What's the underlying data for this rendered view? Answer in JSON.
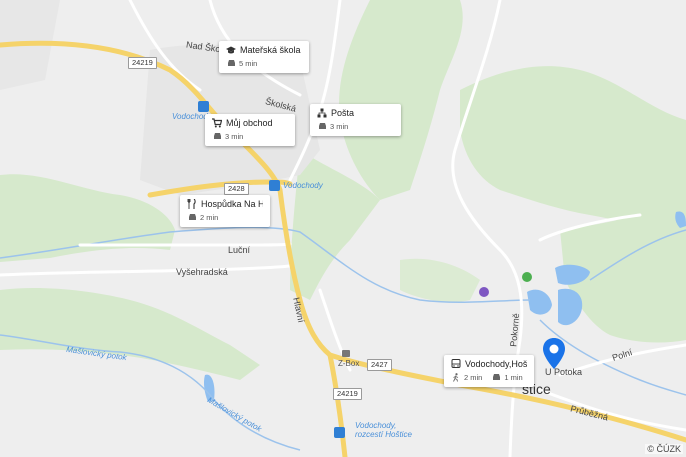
{
  "poi_cards": [
    {
      "id": "materska",
      "icon": "school-icon",
      "title": "Mateřská škola M...",
      "meta_icon": "car-icon",
      "time": "5 min"
    },
    {
      "id": "obchod",
      "icon": "shop-cart-icon",
      "title": "Můj obchod",
      "meta_icon": "car-icon",
      "time": "3 min"
    },
    {
      "id": "posta",
      "icon": "post-office-icon",
      "title": "Pošta",
      "meta_icon": "car-icon",
      "time": "3 min"
    },
    {
      "id": "hospudka",
      "icon": "restaurant-icon",
      "title": "Hospůdka Na Hřišti",
      "meta_icon": "car-icon",
      "time": "2 min"
    },
    {
      "id": "vodochody",
      "icon": "bus-icon",
      "title": "Vodochody,Hoštice",
      "walk_time": "2 min",
      "car_time": "1 min"
    }
  ],
  "road_numbers": [
    "24219",
    "2428",
    "2427",
    "24219"
  ],
  "street_names": [
    "Nad Škol",
    "Školská",
    "Luční",
    "Vyšehradská",
    "Hlavní",
    "Pokorně",
    "Polní",
    "Průběžná",
    "U Potoka"
  ],
  "stop_labels": [
    "Vodochod",
    "Vodochody",
    "Vodochody, rozcestí Hoštice"
  ],
  "poi_labels": [
    "Z-Box"
  ],
  "water_labels": [
    "Mašlovický potok",
    "Mašlovický potok"
  ],
  "town": {
    "name": "Hoštice",
    "shown_text": "štice"
  },
  "copyright": "© ČÚZK",
  "colors": {
    "forest": "#cfe3c2",
    "field": "#e4e4e4",
    "road_major": "#f7d774",
    "road_minor": "#ffffff",
    "water": "#8fbff0",
    "pin": "#1a73e8"
  }
}
